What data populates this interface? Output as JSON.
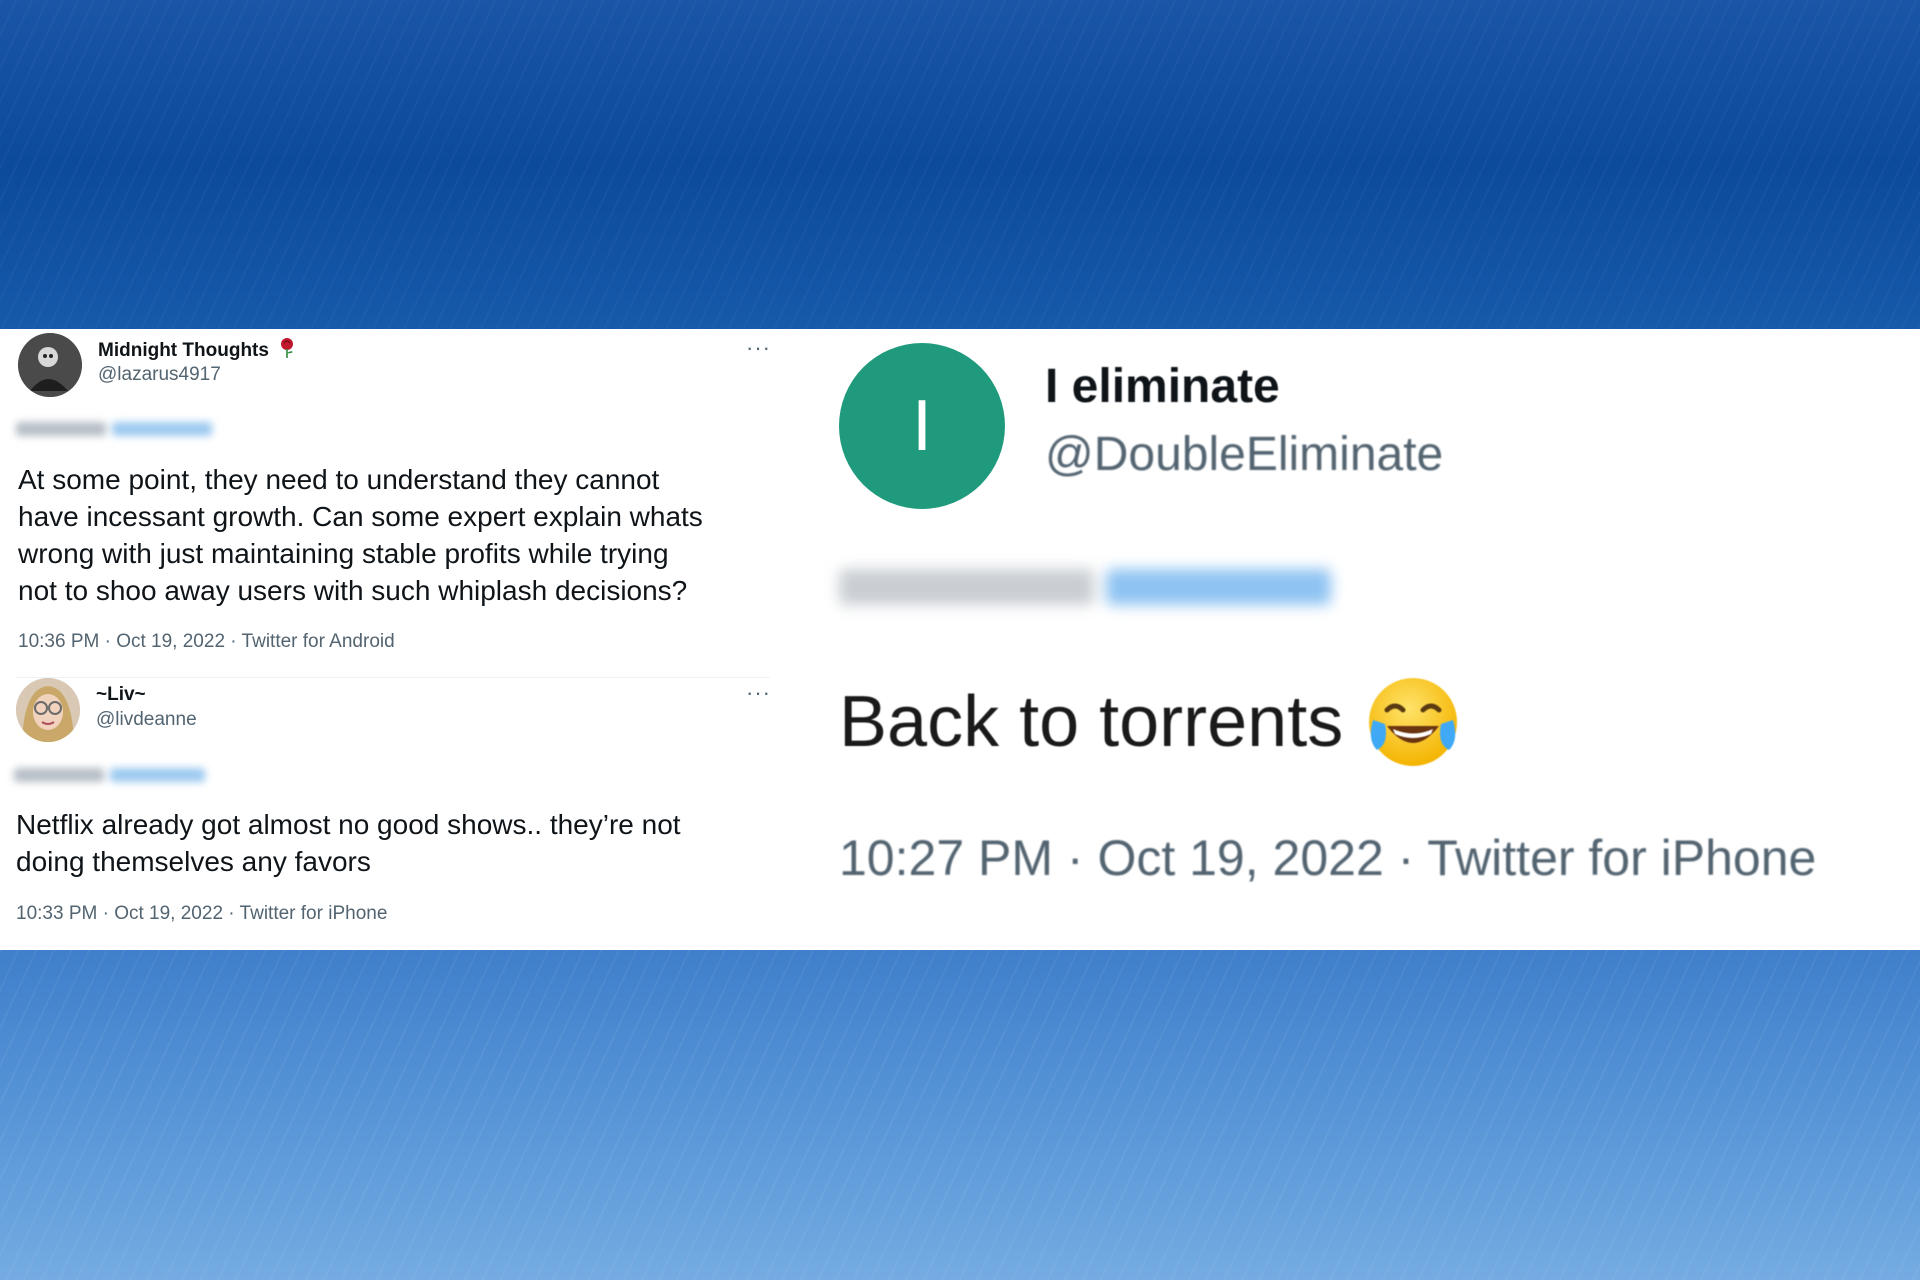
{
  "tweets_left": [
    {
      "name": "Midnight Thoughts",
      "handle": "@lazarus4917",
      "text_lines": [
        "At some point, they need to understand they cannot",
        "have incessant growth. Can some expert explain whats",
        "wrong with just maintaining stable profits while trying",
        "not to shoo away users with such whiplash decisions?"
      ],
      "meta": "10:36 PM · Oct 19, 2022 · Twitter for Android",
      "more_label": "···"
    },
    {
      "name": "~Liv~",
      "handle": "@livdeanne",
      "text_lines": [
        "Netflix already got almost no good shows.. they’re not",
        "doing themselves any favors"
      ],
      "meta": "10:33 PM · Oct 19, 2022 · Twitter for iPhone",
      "more_label": "···"
    }
  ],
  "tweet_right": {
    "avatar_letter": "I",
    "name": "I eliminate",
    "handle": "@DoubleEliminate",
    "text": "Back to torrents",
    "meta": "10:27 PM · Oct 19, 2022 · Twitter for iPhone"
  },
  "colors": {
    "avatar_green": "#1f9a7c",
    "text_primary": "#0f1419",
    "text_secondary": "#536471",
    "rose_emoji": "#c0182c"
  },
  "icons": [
    "rose-icon",
    "more-options-icon",
    "tears-of-joy-emoji"
  ]
}
